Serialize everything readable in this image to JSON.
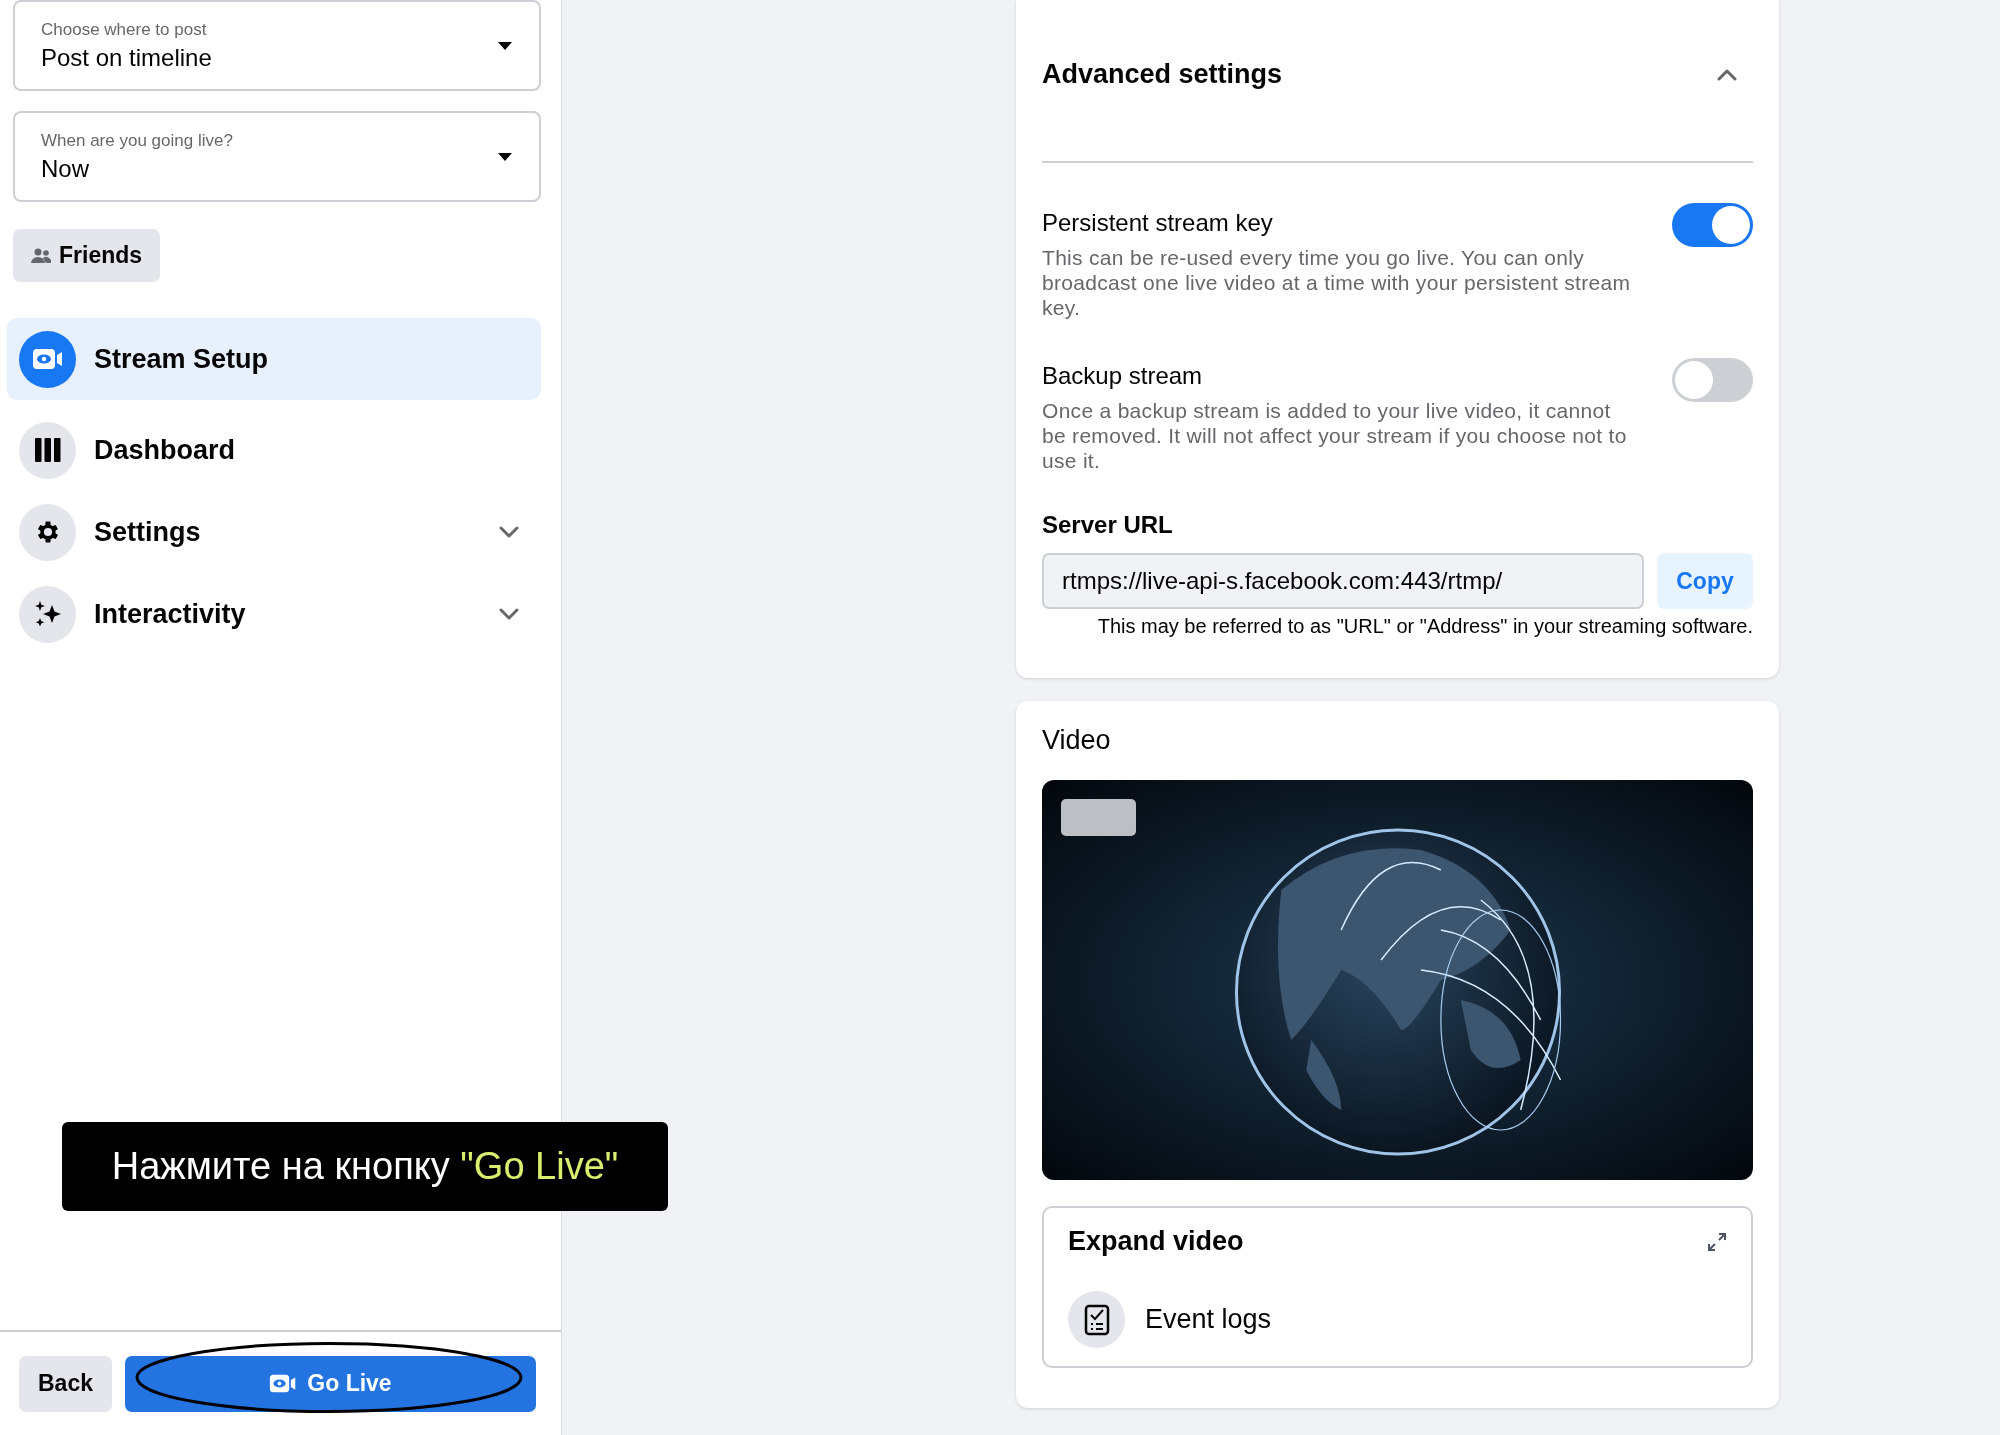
{
  "sidebar": {
    "dropdowns": [
      {
        "label": "Choose where to post",
        "value": "Post on timeline"
      },
      {
        "label": "When are you going live?",
        "value": "Now"
      }
    ],
    "audience_button": "Friends",
    "nav": [
      {
        "label": "Stream Setup",
        "selected": true,
        "expandable": false
      },
      {
        "label": "Dashboard",
        "selected": false,
        "expandable": false
      },
      {
        "label": "Settings",
        "selected": false,
        "expandable": true
      },
      {
        "label": "Interactivity",
        "selected": false,
        "expandable": true
      }
    ],
    "footer": {
      "back": "Back",
      "go_live": "Go Live"
    }
  },
  "tooltip": {
    "text": "Нажмите на кнопку",
    "highlight": "\"Go Live\""
  },
  "advanced_settings": {
    "title": "Advanced settings",
    "expanded": true,
    "toggles": [
      {
        "title": "Persistent stream key",
        "description": "This can be re-used every time you go live. You can only broadcast one live video at a time with your persistent stream key.",
        "on": true
      },
      {
        "title": "Backup stream",
        "description": "Once a backup stream is added to your live video, it cannot be removed. It will not affect your stream if you choose not to use it.",
        "on": false
      }
    ],
    "server_url": {
      "label": "Server URL",
      "value": "rtmps://live-api-s.facebook.com:443/rtmp/",
      "button": "Copy",
      "hint": "This may be referred to as \"URL\" or \"Address\" in your streaming software."
    }
  },
  "video": {
    "title": "Video",
    "expand": "Expand video",
    "event_logs": "Event logs"
  }
}
